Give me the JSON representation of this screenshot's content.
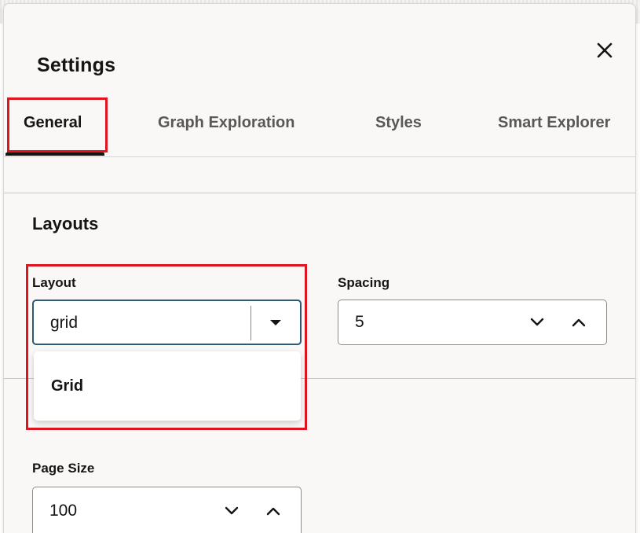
{
  "dialog": {
    "title": "Settings",
    "close_icon": "close-icon"
  },
  "tabs": [
    {
      "label": "General",
      "active": true
    },
    {
      "label": "Graph Exploration",
      "active": false
    },
    {
      "label": "Styles",
      "active": false
    },
    {
      "label": "Smart Explorer",
      "active": false
    }
  ],
  "layouts": {
    "section_title": "Layouts",
    "layout": {
      "label": "Layout",
      "value": "grid",
      "icon": "caret-down-icon",
      "options": [
        "Grid"
      ]
    },
    "spacing": {
      "label": "Spacing",
      "value": "5",
      "decrement_icon": "chevron-down-icon",
      "increment_icon": "chevron-up-icon"
    },
    "page_size": {
      "label": "Page Size",
      "value": "100",
      "decrement_icon": "chevron-down-icon",
      "increment_icon": "chevron-up-icon"
    }
  },
  "colors": {
    "highlight": "#e0141e",
    "focus_border": "#2e5a73",
    "dialog_bg": "#f9f8f6"
  }
}
